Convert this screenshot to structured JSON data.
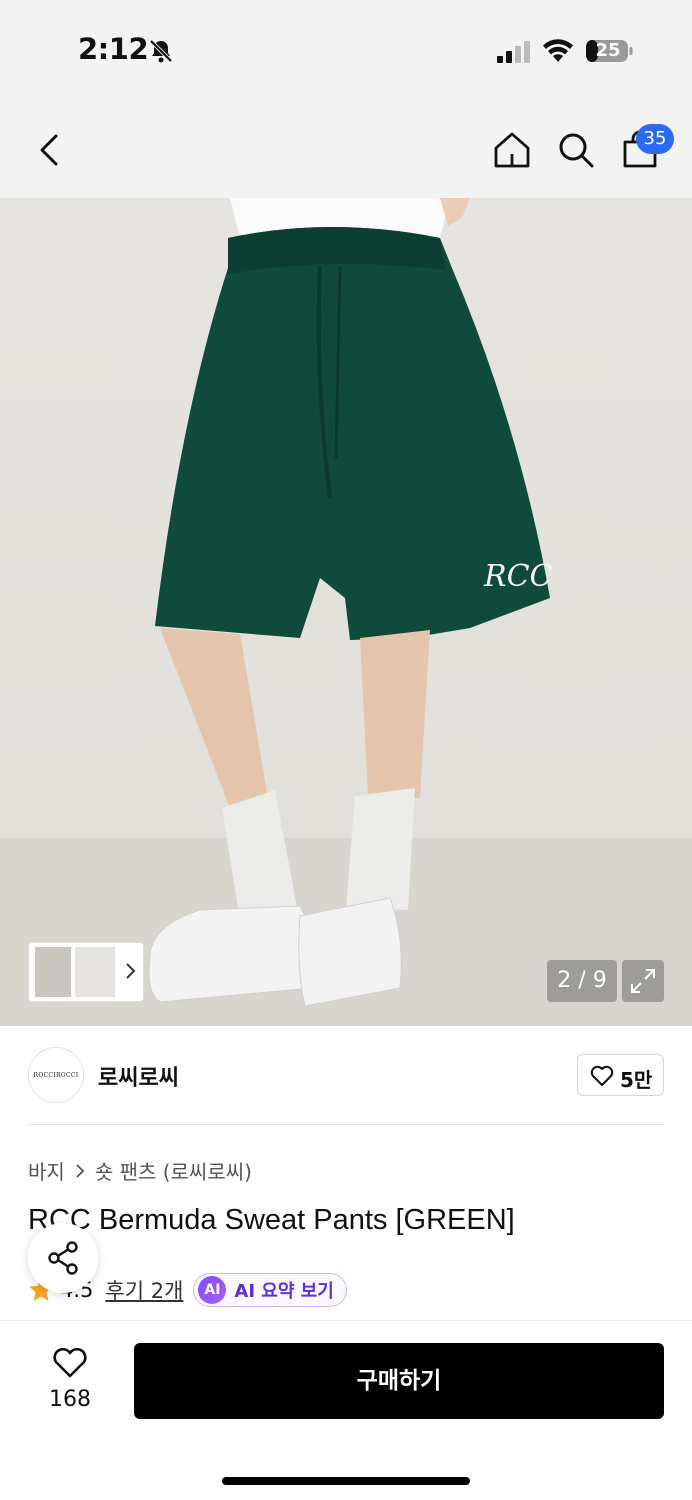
{
  "status_bar": {
    "time": "2:12",
    "battery": "25",
    "icons": [
      "bell-off-icon",
      "signal-icon",
      "wifi-icon",
      "battery-icon"
    ]
  },
  "nav": {
    "cart_count": "35",
    "icons": [
      "back-icon",
      "home-icon",
      "search-icon",
      "cart-icon"
    ]
  },
  "hero": {
    "counter": "2 / 9",
    "logo_text": "RCC"
  },
  "brand": {
    "logo_text": "ROCCIROCCI",
    "name": "로씨로씨",
    "fav_count": "5만"
  },
  "product": {
    "breadcrumb": [
      "바지",
      "숏 팬츠 (로씨로씨)"
    ],
    "title": "RCC Bermuda Sweat Pants [GREEN]",
    "rating": "4.5",
    "reviews": "후기 2개",
    "ai_badge": "AI",
    "ai_label": "AI 요약 보기"
  },
  "bottom": {
    "like_count": "168",
    "buy_label": "구매하기"
  },
  "colors": {
    "accent": "#2b6bf3",
    "pants": "#0f4a3a",
    "star": "#f5a623",
    "ai": "#6a3df0"
  }
}
